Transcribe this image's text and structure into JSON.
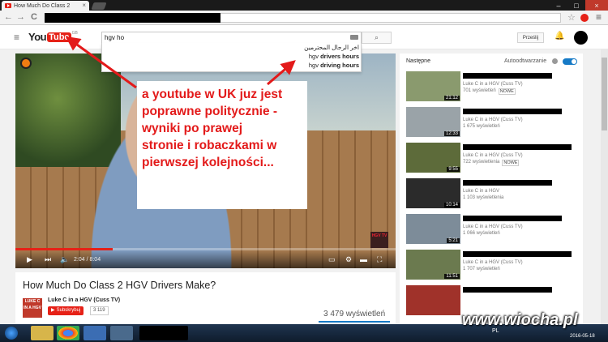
{
  "browser": {
    "tab_title": "How Much Do Class 2",
    "tab_close": "×",
    "nav_back": "←",
    "nav_forward": "→",
    "nav_reload": "C",
    "window_controls": [
      "–",
      "□",
      "×"
    ],
    "star": "☆",
    "menu": "≡"
  },
  "masthead": {
    "menu_icon": "≡",
    "logo_you": "You",
    "logo_tube": "Tube",
    "logo_region": "GB",
    "search_value": "hgv ho",
    "search_button": "⌕",
    "upload_label": "Prześlij",
    "bell": "🔔"
  },
  "suggestions": [
    {
      "text": "اخر الرجال المحترمين",
      "bold": ""
    },
    {
      "prefix": "hgv ",
      "bold": "drivers hours"
    },
    {
      "prefix": "hgv ",
      "bold": "driving hours"
    }
  ],
  "player": {
    "time_current": "2:04",
    "time_total": "8:04",
    "time_display": "2:04 / 8:04",
    "progress": 0.256,
    "watermark": "HGV TV"
  },
  "annotation": {
    "lines": [
      "a youtube w UK juz jest",
      "poprawne politycznie -",
      "wyniki po prawej",
      "stronie i robaczkami w",
      "pierwszej kolejności..."
    ],
    "color": "#e31a1a"
  },
  "video": {
    "title": "How Much Do Class 2 HGV Drivers Make?",
    "channel_thumb": "LUKE C IN A HGV",
    "channel": "Luke C in a HGV (Cuss TV)",
    "subscribe_label": "Subskrybuj",
    "subscriber_count": "3 119",
    "views": "3 479 wyświetleń"
  },
  "sidebar": {
    "next_label": "Następne",
    "autoplay_label": "Autoodtwarzanie",
    "recommendations": [
      {
        "duration": "21:12",
        "author": "Luke C in a HGV (Cuss TV)",
        "views": "701 wyświetleń",
        "badge": "NOWE",
        "thumb_color": "#8a9a6e"
      },
      {
        "duration": "12:33",
        "author": "Luke C in a HGV (Cuss TV)",
        "views": "1 675 wyświetleń",
        "badge": "",
        "thumb_color": "#9aa3a8"
      },
      {
        "duration": "9:55",
        "author": "Luke C in a HGV (Cuss TV)",
        "views": "722 wyświetlenia",
        "badge": "NOWE",
        "thumb_color": "#5d6b3a"
      },
      {
        "duration": "10:14",
        "author": "Luke C in a HGV",
        "views": "1 103 wyświetlenia",
        "badge": "",
        "thumb_color": "#2b2b2b"
      },
      {
        "duration": "5:21",
        "author": "Luke C in a HGV (Cuss TV)",
        "views": "1 066 wyświetleń",
        "badge": "",
        "thumb_color": "#7d8c99"
      },
      {
        "duration": "11:51",
        "author": "Luke C in a HGV (Cuss TV)",
        "views": "1 707 wyświetleń",
        "badge": "",
        "thumb_color": "#6b7a4f"
      },
      {
        "duration": "",
        "author": "",
        "views": "",
        "badge": "",
        "thumb_color": "#a0322a"
      }
    ]
  },
  "taskbar": {
    "lang": "PL",
    "date": "2016-05-18"
  },
  "site_watermark": "www.wiocha.pl"
}
